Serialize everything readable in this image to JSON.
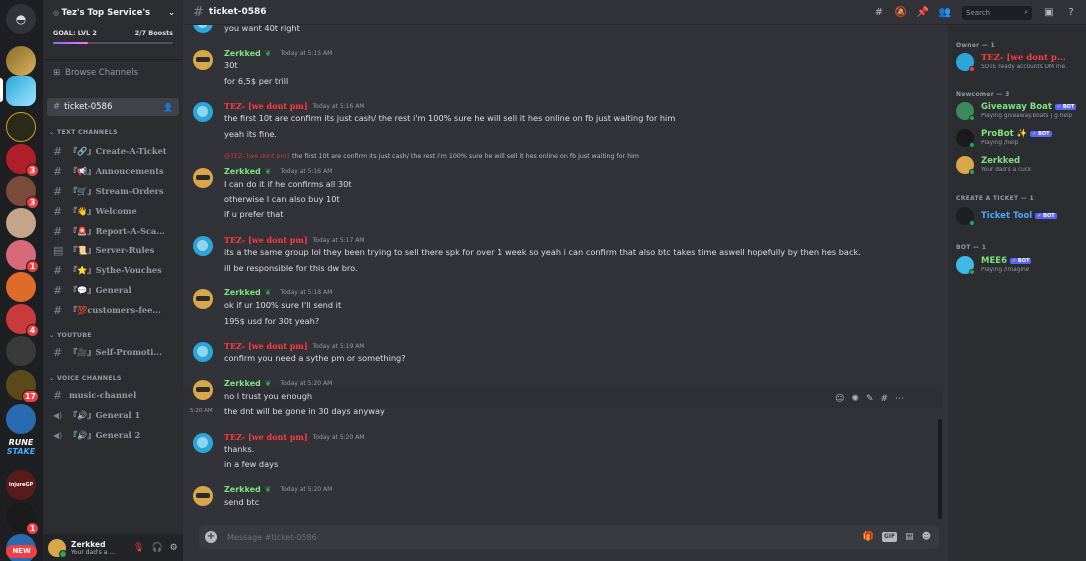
{
  "guild": {
    "name": "Tez's Top Service's",
    "goal": "GOAL: LVL 2",
    "boosts": "2/7 Boosts",
    "goal_progress": 0.29
  },
  "sidebar": {
    "browse": "Browse Channels",
    "active_channel": "ticket-0586",
    "categories": {
      "text": "TEXT CHANNELS",
      "youtube": "YOUTUBE",
      "voice": "VOICE CHANNELS"
    },
    "text_channels": [
      "『🔗』Create-A-Ticket",
      "『📢』Annoucements",
      "『🛒』Stream-Orders",
      "『👋』Welcome",
      "『🚨』Report-A-Sca...",
      "『📜』Server-Rules",
      "『⭐』Sythe-Vouches",
      "『💬』General",
      "『💯customers-fee..."
    ],
    "youtube_channels": [
      "『🎥』Self-Promoti..."
    ],
    "voice_channels": [
      "music-channel",
      "『🔊』General 1",
      "『🔊』General 2"
    ]
  },
  "rail": {
    "badges": [
      "3",
      "3",
      "1",
      "4",
      "17",
      "1"
    ],
    "rune_line1": "RUNE",
    "rune_line2": "STAKE",
    "injure": "InjureGP",
    "new": "NEW"
  },
  "user": {
    "name": "Zerkked",
    "status": "Your dad's a ..."
  },
  "topbar": {
    "channel": "ticket-0586",
    "search_placeholder": "Search"
  },
  "messages": [
    {
      "type": "cont",
      "lines": [
        "you want 40t right"
      ]
    },
    {
      "author": "Zerkked",
      "who": "z",
      "time": "Today at 5:15 AM",
      "lines": [
        "30t",
        "for 6,5$ per trill"
      ]
    },
    {
      "author": "TEZ- [we dont pm]",
      "who": "t",
      "time": "Today at 5:16 AM",
      "lines": [
        "the first 10t are confirm its just cash/ the rest i'm 100% sure he will sell it hes online on fb just waiting  for him",
        "yeah its fine."
      ]
    },
    {
      "author": "Zerkked",
      "who": "z",
      "time": "Today at 5:16 AM",
      "reply_name": "@TEZ- [we dont pm]",
      "reply": "the first 10t are confirm its just cash/ the rest i'm 100% sure he will sell it hes online on fb just waiting for him",
      "lines": [
        "I can do it if he confirms all 30t",
        "otherwise I can also buy 10t",
        "if u prefer that"
      ]
    },
    {
      "author": "TEZ- [we dont pm]",
      "who": "t",
      "time": "Today at 5:17 AM",
      "lines": [
        "its a the same group  lol they been trying to sell there spk for over 1 week so yeah i can confirm that also btc takes time aswell hopefully by then hes back.",
        "ill be responsible for this dw bro."
      ]
    },
    {
      "author": "Zerkked",
      "who": "z",
      "time": "Today at 5:18 AM",
      "lines": [
        "ok if ur 100% sure I'll send it",
        "195$ usd for 30t yeah?"
      ]
    },
    {
      "author": "TEZ- [we dont pm]",
      "who": "t",
      "time": "Today at 5:19 AM",
      "lines": [
        "confirm you need a sythe pm or something?"
      ]
    },
    {
      "author": "Zerkked",
      "who": "z",
      "time": "Today at 5:20 AM",
      "lines": [
        "no I trust you enough"
      ],
      "hover_time": "5:20 AM",
      "hover_line": "the dnt will be gone in 30 days anyway"
    },
    {
      "author": "TEZ- [we dont pm]",
      "who": "t",
      "time": "Today at 5:20 AM",
      "lines": [
        "thanks.",
        "in a few days"
      ]
    },
    {
      "author": "Zerkked",
      "who": "z",
      "time": "Today at 5:20 AM",
      "lines": [
        "send btc"
      ]
    }
  ],
  "composer": {
    "placeholder": "Message #ticket-0586",
    "gif": "GIF"
  },
  "members": {
    "owner_cat": "Owner — 1",
    "newcomer_cat": "Newcomer — 3",
    "ticket_cat": "CREATE A TICKET — 1",
    "bot_cat": "BOT — 1",
    "bot_tag": "✓ BOT",
    "list": [
      {
        "name": "TEZ- [we dont p...",
        "sub": "SOTE ready accounts DM me.",
        "color": "#ff3b3b"
      },
      {
        "name": "Giveaway Boat",
        "sub": "Playing giveaway.boats | g.help",
        "color": "#7de37d",
        "bot": true
      },
      {
        "name": "ProBot ✨",
        "sub": "Playing /help",
        "color": "#7de37d",
        "bot": true
      },
      {
        "name": "Zerkked",
        "sub": "Your dad's a cuck",
        "color": "#7de37d"
      },
      {
        "name": "Ticket Tool",
        "sub": "",
        "color": "#4aa8ff",
        "bot": true
      },
      {
        "name": "MEE6",
        "sub": "Playing /imagine",
        "color": "#7de37d",
        "bot": true
      }
    ]
  },
  "colors": {
    "accent": "#5865f2",
    "tez": "#ff3b3b",
    "zerkked": "#7de37d",
    "online": "#23a55a"
  }
}
